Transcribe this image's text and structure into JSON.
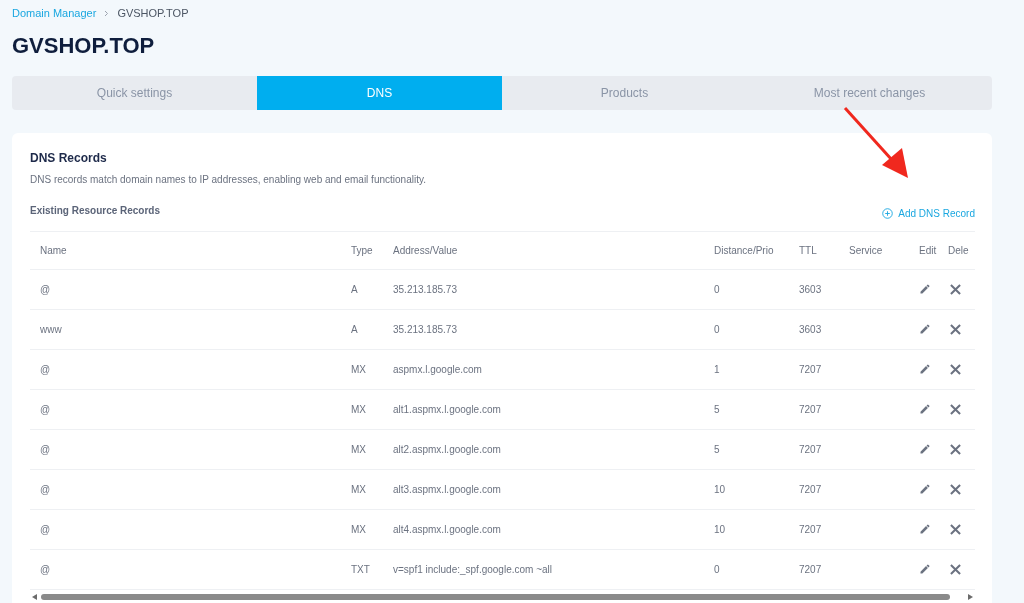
{
  "breadcrumb": {
    "link": "Domain Manager",
    "current": "GVSHOP.TOP"
  },
  "title": "GVSHOP.TOP",
  "tabs": [
    {
      "label": "Quick settings",
      "selected": false
    },
    {
      "label": "DNS",
      "selected": true
    },
    {
      "label": "Products",
      "selected": false
    },
    {
      "label": "Most recent changes",
      "selected": false
    }
  ],
  "card": {
    "title": "DNS Records",
    "description": "DNS records match domain names to IP addresses, enabling web and email functionality.",
    "subtitle": "Existing Resource Records",
    "add_button": "Add DNS Record"
  },
  "table": {
    "columns": [
      "Name",
      "Type",
      "Address/Value",
      "Distance/Prio",
      "TTL",
      "Service",
      "Edit",
      "Dele"
    ],
    "rows": [
      {
        "name": "@",
        "type": "A",
        "value": "35.213.185.73",
        "prio": "0",
        "ttl": "3603"
      },
      {
        "name": "www",
        "type": "A",
        "value": "35.213.185.73",
        "prio": "0",
        "ttl": "3603"
      },
      {
        "name": "@",
        "type": "MX",
        "value": "aspmx.l.google.com",
        "prio": "1",
        "ttl": "7207"
      },
      {
        "name": "@",
        "type": "MX",
        "value": "alt1.aspmx.l.google.com",
        "prio": "5",
        "ttl": "7207"
      },
      {
        "name": "@",
        "type": "MX",
        "value": "alt2.aspmx.l.google.com",
        "prio": "5",
        "ttl": "7207"
      },
      {
        "name": "@",
        "type": "MX",
        "value": "alt3.aspmx.l.google.com",
        "prio": "10",
        "ttl": "7207"
      },
      {
        "name": "@",
        "type": "MX",
        "value": "alt4.aspmx.l.google.com",
        "prio": "10",
        "ttl": "7207"
      },
      {
        "name": "@",
        "type": "TXT",
        "value": "v=spf1 include:_spf.google.com ~all",
        "prio": "0",
        "ttl": "7207"
      }
    ]
  }
}
